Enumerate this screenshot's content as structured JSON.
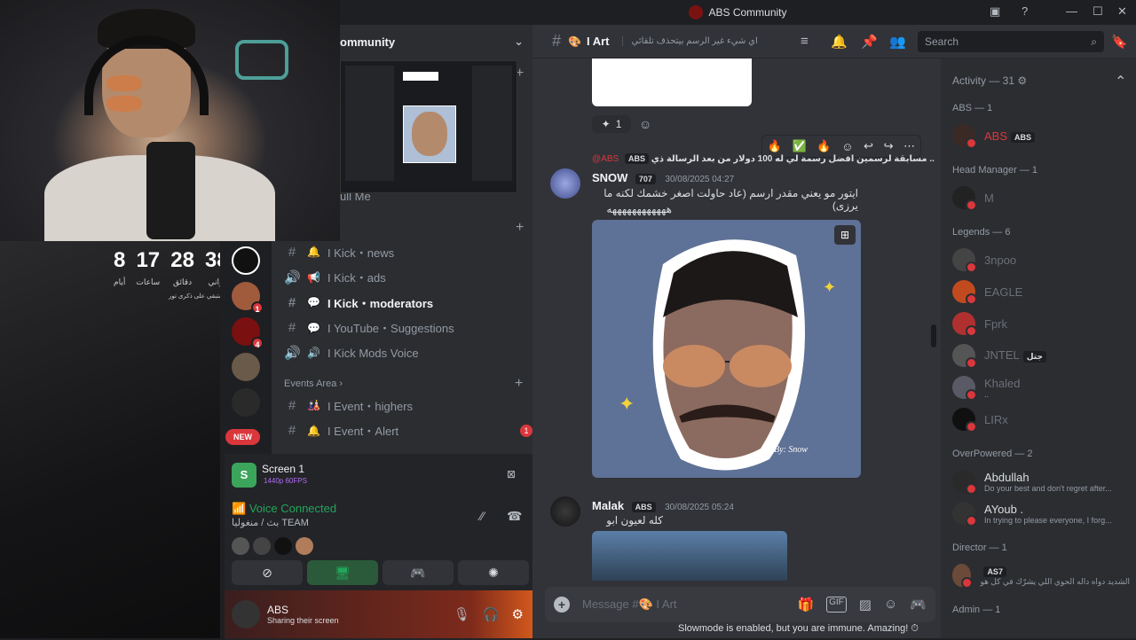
{
  "window": {
    "title": "ABS Community",
    "minimize": "—",
    "maximize": "☐",
    "close": "✕"
  },
  "server": {
    "name_visible": "ommunity",
    "chevron": "⌄"
  },
  "countdown": [
    {
      "n": "8",
      "l": "أيام"
    },
    {
      "n": "17",
      "l": "ساعات"
    },
    {
      "n": "28",
      "l": "دقائق"
    },
    {
      "n": "38",
      "l": "ثواني"
    }
  ],
  "countdown_note": "متبقي على ذكرى تور",
  "screenshare_peek": "ull Me",
  "servers": [
    {
      "badge": "1",
      "color": "#a05a3c"
    },
    {
      "badge": "4",
      "color": "#7a1010"
    },
    {
      "badge": "",
      "color": "#6a5a4a"
    },
    {
      "badge": "",
      "color": "#2a2a2a"
    }
  ],
  "server_new_label": "NEW",
  "channels": [
    {
      "hash": "#",
      "emoji": "🔔",
      "label": "I Kick・news",
      "active": false
    },
    {
      "hash": "🔊",
      "emoji": "📢",
      "label": "I Kick・ads",
      "active": false
    },
    {
      "hash": "#",
      "emoji": "💬",
      "label": "I Kick・moderators",
      "active": true
    },
    {
      "hash": "#",
      "emoji": "💬",
      "label": "I YouTube・Suggestions",
      "active": false
    },
    {
      "hash": "🔊",
      "emoji": "🔊",
      "label": "I Kick Mods Voice",
      "active": false
    }
  ],
  "events_category": "Events Area",
  "events_chevron": "›",
  "event_channels": [
    {
      "hash": "#",
      "emoji": "🎎",
      "label": "I Event・highers",
      "badge": ""
    },
    {
      "hash": "#",
      "emoji": "🔔",
      "label": "I Event・Alert",
      "badge": "1"
    }
  ],
  "screen_share": {
    "title": "Screen 1",
    "quality": "1440p 60FPS",
    "avatar_letter": "S"
  },
  "voice": {
    "status": "Voice Connected",
    "channel": "بث / منغوليا TEAM"
  },
  "voice_buttons": [
    "⊘",
    "🖥",
    "🎮",
    "✺"
  ],
  "user": {
    "name": "ABS",
    "status": "Sharing their screen"
  },
  "chat_header": {
    "channel": "I Art",
    "topic": "اي شيء غير الرسم بيتحذف تلقائي"
  },
  "search": {
    "placeholder": "Search"
  },
  "reaction": {
    "count": "1"
  },
  "hover_bar": [
    "🔥",
    "✅",
    "🔥",
    "☺",
    "↩",
    "↪",
    "⋯"
  ],
  "reply_preview": {
    "author": "@ABS",
    "tag": "ABS",
    "text": "مسابقة لرسمين افضل رسمة لي له 100 دولار من بعد الرسالة ذي .."
  },
  "messages": [
    {
      "author": "SNOW",
      "tag": "707",
      "time": "30/08/2025 04:27",
      "lines": [
        "ايتور مو يعني مقدر ارسم (عاد حاولت اصغر خشمك لكنه ما يرزى)",
        "ههههههههههههه"
      ]
    },
    {
      "author": "Malak",
      "tag": "ABS",
      "time": "30/08/2025 05:24",
      "lines": [
        "كله لعيون ابو سعد"
      ]
    }
  ],
  "artwork_signature": "By: Snow",
  "composer": {
    "placeholder": "Message #🎨 I Art"
  },
  "slowmode": "Slowmode is enabled, but you are immune. Amazing!",
  "members": {
    "activity_header": "Activity — 31",
    "sections": [
      {
        "title": "ABS — 1",
        "users": [
          {
            "name": "ABS",
            "tag": "ABS",
            "sub": "",
            "color": "#da373c"
          }
        ]
      },
      {
        "title": "Head Manager — 1",
        "users": [
          {
            "name": "M",
            "tag": "",
            "sub": "",
            "color": "#6d6f78"
          }
        ]
      },
      {
        "title": "Legends — 6",
        "users": [
          {
            "name": "3npoo",
            "tag": "",
            "sub": "",
            "color": "#6d6f78"
          },
          {
            "name": "EAGLE",
            "tag": "",
            "sub": "",
            "color": "#6d6f78"
          },
          {
            "name": "Fprk",
            "tag": "",
            "sub": "",
            "color": "#6d6f78"
          },
          {
            "name": "JNTEL",
            "tag": "جتل",
            "sub": "",
            "color": "#6d6f78"
          },
          {
            "name": "Khaled",
            "tag": "",
            "sub": "..",
            "color": "#6d6f78"
          },
          {
            "name": "LIRx",
            "tag": "",
            "sub": "",
            "color": "#6d6f78"
          }
        ]
      },
      {
        "title": "OverPowered — 2",
        "users": [
          {
            "name": "Abdullah",
            "tag": "",
            "sub": "Do your best and don't regret after...",
            "color": "#dbdee1"
          },
          {
            "name": "AYoub .",
            "tag": "",
            "sub": "In trying to please everyone, I forg...",
            "color": "#dbdee1"
          }
        ]
      },
      {
        "title": "Director — 1",
        "users": [
          {
            "name": "",
            "tag": "AS7",
            "sub": "الشديد دواه داله الحوي اللي يشرّك في كل هو",
            "color": "#dbdee1"
          }
        ]
      },
      {
        "title": "Admin — 1",
        "users": []
      }
    ]
  },
  "colors": {
    "accent_red": "#da373c",
    "voice_green": "#23a55a",
    "purple": "#b06cf2"
  }
}
